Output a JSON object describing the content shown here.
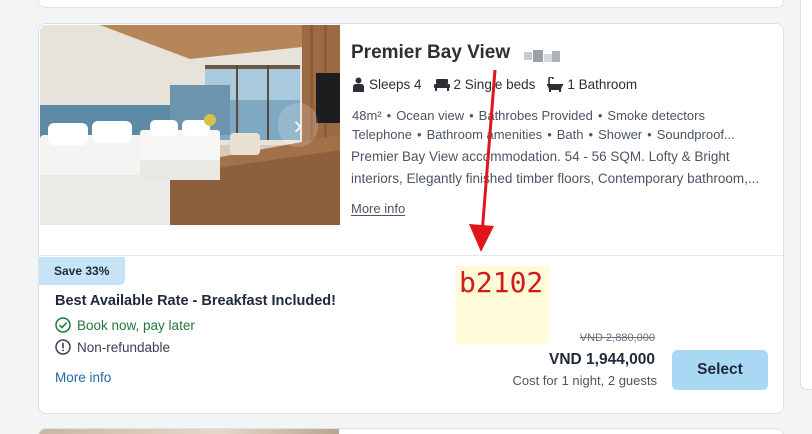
{
  "room": {
    "title": "Premier Bay View",
    "sleeps": "Sleeps 4",
    "beds": "2 Single beds",
    "bathroom": "1 Bathroom",
    "features": [
      "48m²",
      "Ocean view",
      "Bathrobes Provided",
      "Smoke detectors",
      "Telephone",
      "Bathroom amenities",
      "Bath",
      "Shower",
      "Soundproof..."
    ],
    "description": "Premier Bay View accommodation. 54 - 56 SQM. Lofty & Bright interiors, Elegantly finished timber floors, Contemporary bathroom,...",
    "more_info": "More info"
  },
  "rate": {
    "badge": "Save 33%",
    "name": "Best Available Rate - Breakfast Included!",
    "policy_flexible": "Book now, pay later",
    "policy_refund": "Non-refundable",
    "more_info": "More info",
    "price_original": "VND 2,880,000",
    "price_current": "VND 1,944,000",
    "price_note": "Cost for 1 night, 2 guests",
    "select_label": "Select"
  },
  "annotation": {
    "label": "b2102",
    "color": "#d11a1a"
  },
  "icons": {
    "next_photo": "chevron-right-icon",
    "sleeps": "person-icon",
    "beds": "bed-icon",
    "bathroom": "bathtub-icon",
    "flexible": "check-circle-icon",
    "refund": "info-circle-icon"
  }
}
